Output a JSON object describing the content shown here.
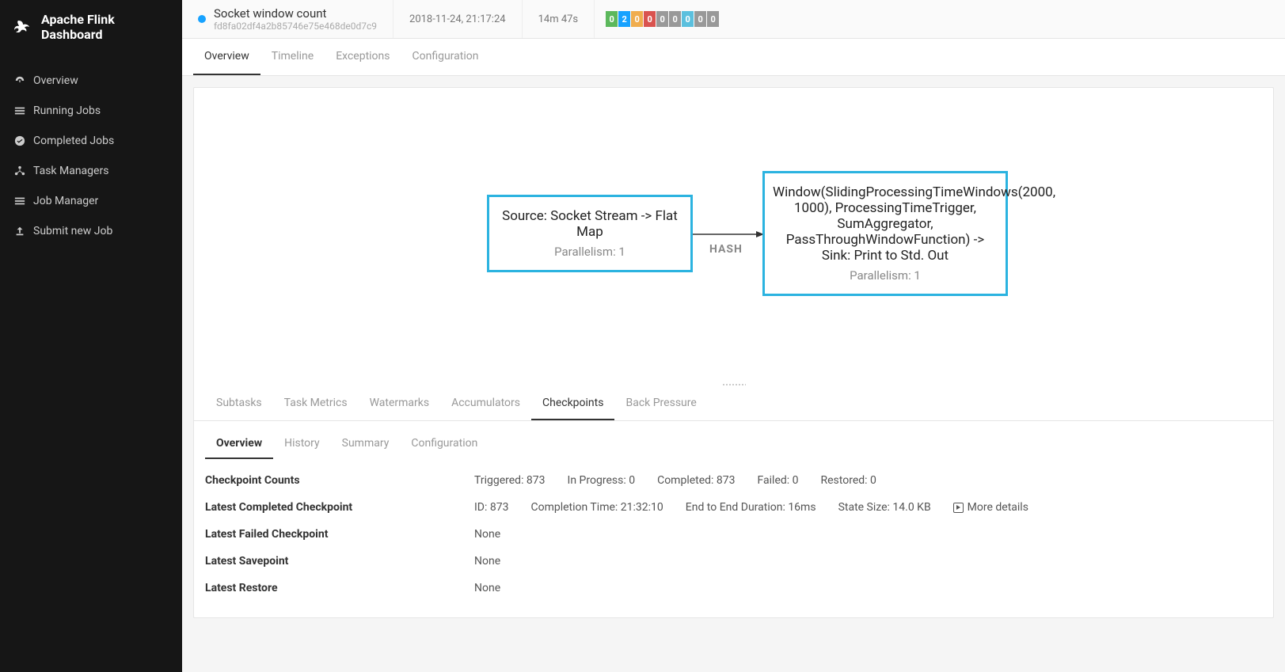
{
  "app": {
    "title": "Apache Flink Dashboard"
  },
  "sidebar": {
    "items": [
      {
        "label": "Overview",
        "icon": "dashboard-icon"
      },
      {
        "label": "Running Jobs",
        "icon": "list-icon"
      },
      {
        "label": "Completed Jobs",
        "icon": "check-circle-icon"
      },
      {
        "label": "Task Managers",
        "icon": "nodes-icon"
      },
      {
        "label": "Job Manager",
        "icon": "list-icon"
      },
      {
        "label": "Submit new Job",
        "icon": "upload-icon"
      }
    ]
  },
  "job": {
    "name": "Socket window count",
    "id": "fd8fa02df4a2b85746e75e468de0d7c9",
    "timestamp": "2018-11-24, 21:17:24",
    "duration": "14m 47s",
    "statusColor": "#17a2ff",
    "counters": [
      {
        "value": "0",
        "color": "#5cb85c"
      },
      {
        "value": "2",
        "color": "#17a2ff"
      },
      {
        "value": "0",
        "color": "#f0ad4e"
      },
      {
        "value": "0",
        "color": "#d9534f"
      },
      {
        "value": "0",
        "color": "#999"
      },
      {
        "value": "0",
        "color": "#999"
      },
      {
        "value": "0",
        "color": "#5bc0de"
      },
      {
        "value": "0",
        "color": "#999"
      },
      {
        "value": "0",
        "color": "#999"
      }
    ]
  },
  "mainTabs": [
    "Overview",
    "Timeline",
    "Exceptions",
    "Configuration"
  ],
  "mainTabActive": 0,
  "graph": {
    "node1": {
      "title": "Source: Socket Stream -> Flat Map",
      "sub": "Parallelism: 1"
    },
    "node2": {
      "title": "Window(SlidingProcessingTimeWindows(2000, 1000), ProcessingTimeTrigger, SumAggregator, PassThroughWindowFunction) -> Sink: Print to Std. Out",
      "sub": "Parallelism: 1"
    },
    "edgeLabel": "HASH"
  },
  "detailTabs": [
    "Subtasks",
    "Task Metrics",
    "Watermarks",
    "Accumulators",
    "Checkpoints",
    "Back Pressure"
  ],
  "detailTabActive": 4,
  "cpTabs": [
    "Overview",
    "History",
    "Summary",
    "Configuration"
  ],
  "cpTabActive": 0,
  "checkpoints": {
    "counts": {
      "label": "Checkpoint Counts",
      "triggered": "Triggered: 873",
      "inProgress": "In Progress: 0",
      "completed": "Completed: 873",
      "failed": "Failed: 0",
      "restored": "Restored: 0"
    },
    "latestCompleted": {
      "label": "Latest Completed Checkpoint",
      "id": "ID: 873",
      "completionTime": "Completion Time: 21:32:10",
      "duration": "End to End Duration: 16ms",
      "stateSize": "State Size: 14.0 KB",
      "more": "More details"
    },
    "latestFailed": {
      "label": "Latest Failed Checkpoint",
      "value": "None"
    },
    "latestSavepoint": {
      "label": "Latest Savepoint",
      "value": "None"
    },
    "latestRestore": {
      "label": "Latest Restore",
      "value": "None"
    }
  }
}
